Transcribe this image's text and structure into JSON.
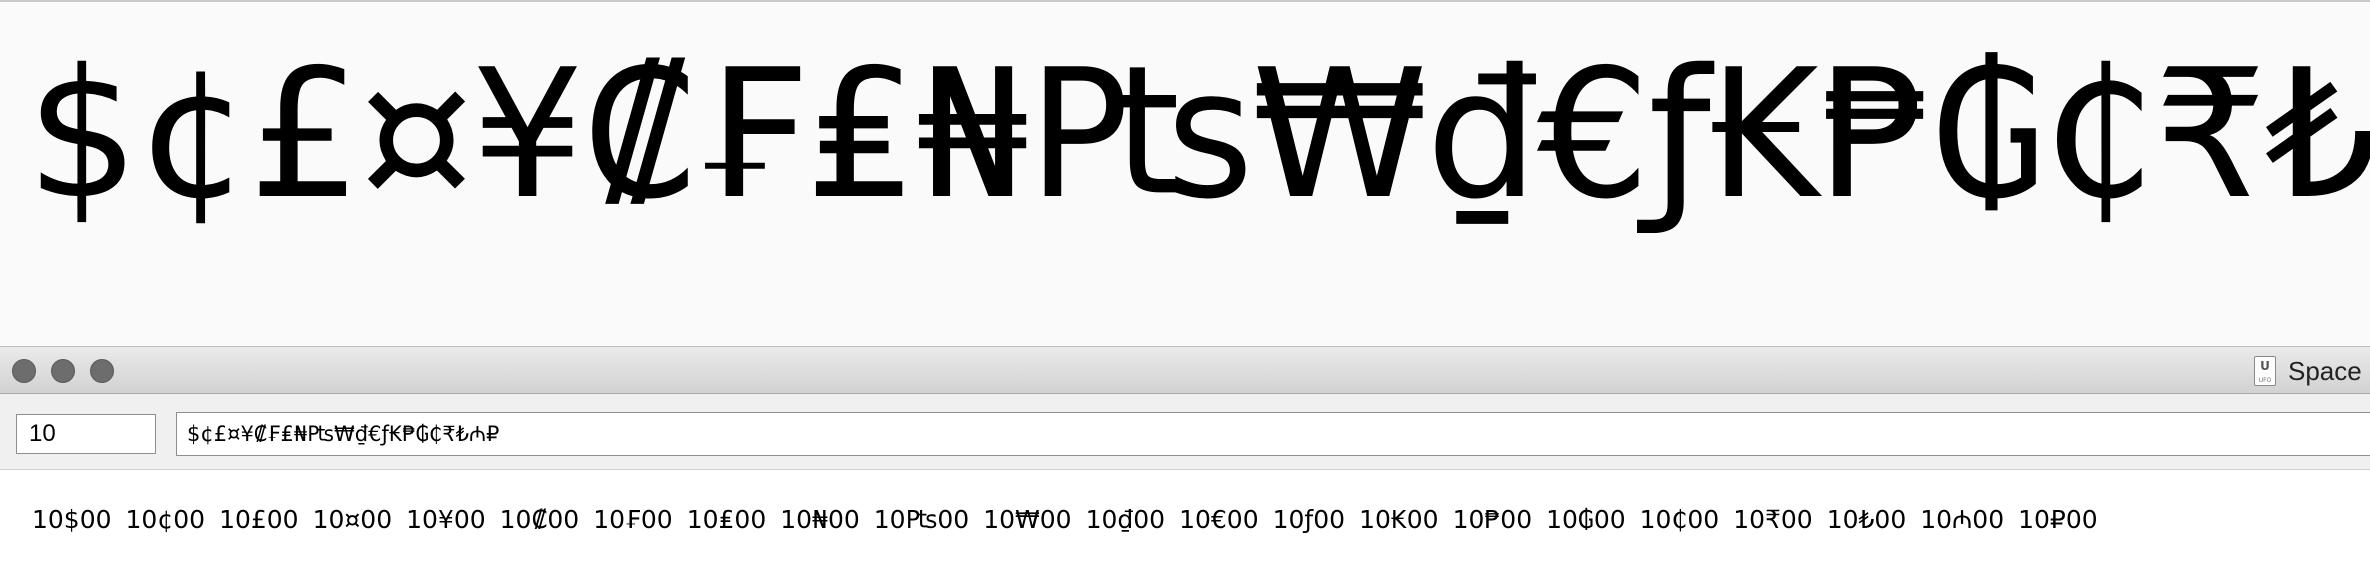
{
  "preview": {
    "glyphs": "$¢£¤¥₡₣₤₦₧₩₫€ƒ₭₱₲₵₹₺₼₽"
  },
  "window": {
    "title": "Space",
    "file_icon_label": "U",
    "file_icon_sublabel": "UFO"
  },
  "toolbar": {
    "size_value": "10",
    "text_value": "$¢£¤¥₡₣₤₦₧₩₫€ƒ₭₱₲₵₹₺₼₽"
  },
  "spacing": {
    "items": [
      "10$00",
      "10¢00",
      "10£00",
      "10¤00",
      "10¥00",
      "10₡00",
      "10₣00",
      "10₤00",
      "10₦00",
      "10₧00",
      "10₩00",
      "10₫00",
      "10€00",
      "10ƒ00",
      "10₭00",
      "10₱00",
      "10₲00",
      "10₵00",
      "10₹00",
      "10₺00",
      "10₼00",
      "10₽00"
    ]
  }
}
